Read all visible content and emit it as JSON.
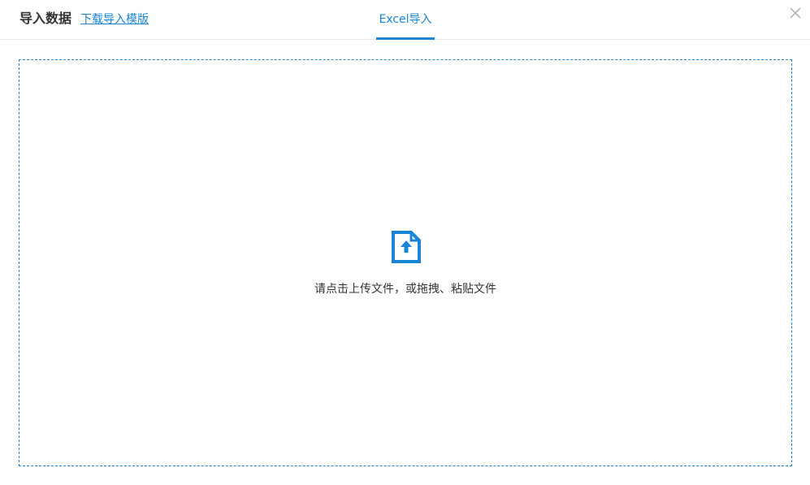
{
  "header": {
    "title": "导入数据",
    "template_link": "下载导入模版",
    "tabs": [
      {
        "label": "Excel导入",
        "active": true
      }
    ]
  },
  "dropzone": {
    "hint": "请点击上传文件，或拖拽、粘贴文件"
  },
  "icons": {
    "close": "close-icon",
    "upload": "file-upload-icon"
  },
  "colors": {
    "accent": "#1a86d8",
    "text": "#333333",
    "border": "#e8e8e8",
    "close_icon": "#aaaaaa"
  }
}
